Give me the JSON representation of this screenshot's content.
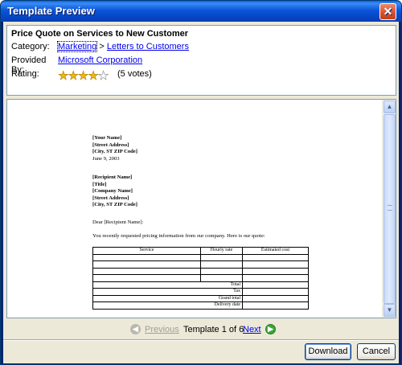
{
  "window": {
    "title": "Template Preview",
    "close_glyph": "✕"
  },
  "info": {
    "title": "Price Quote on Services to New Customer",
    "category_label": "Category:",
    "category_link": "Marketing",
    "category_separator": ">",
    "subcategory_link": "Letters to Customers",
    "provider_label": "Provided By:",
    "provider_link": "Microsoft Corporation",
    "rating_label": "Rating:",
    "rating_stars": 4,
    "rating_max": 5,
    "votes": "(5 votes)"
  },
  "document": {
    "sender": [
      "[Your Name]",
      "[Street Address]",
      "[City, ST  ZIP Code]"
    ],
    "date": "June 9, 2003",
    "recipient": [
      "[Recipient Name]",
      "[Title]",
      "[Company Name]",
      "[Street Address]",
      "[City, ST  ZIP Code]"
    ],
    "salutation": "Dear [Recipient Name]:",
    "intro": "You recently requested pricing information from our company. Here is our quote:",
    "table": {
      "headers": [
        "Service",
        "Hourly rate",
        "Estimated cost"
      ],
      "totals": [
        "Total",
        "Tax",
        "Grand total",
        "Delivery date"
      ]
    }
  },
  "navigation": {
    "previous_label": "Previous",
    "counter": "Template 1 of 6",
    "next_label": "Next"
  },
  "buttons": {
    "download_label": "Download",
    "cancel_label": "Cancel"
  }
}
